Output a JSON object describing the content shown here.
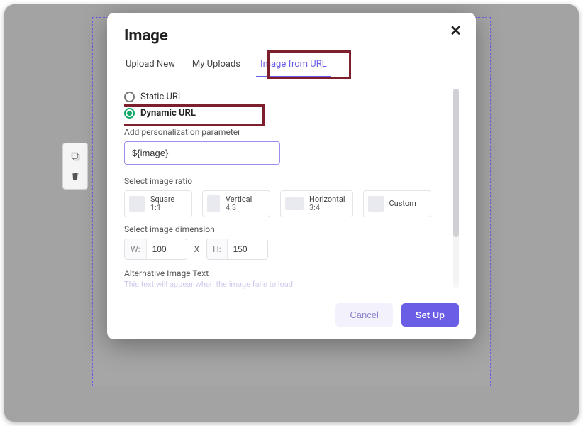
{
  "modal": {
    "title": "Image",
    "tabs": [
      {
        "label": "Upload New",
        "active": false
      },
      {
        "label": "My Uploads",
        "active": false
      },
      {
        "label": "Image from URL",
        "active": true
      }
    ],
    "url_type": {
      "static_label": "Static URL",
      "dynamic_label": "Dynamic URL",
      "selected": "dynamic"
    },
    "param": {
      "label": "Add personalization parameter",
      "value": "${image}"
    },
    "ratio": {
      "label": "Select image ratio",
      "options": [
        {
          "name": "Square",
          "sub": "1:1"
        },
        {
          "name": "Vertical",
          "sub": "4:3"
        },
        {
          "name": "Horizontal",
          "sub": "3:4"
        },
        {
          "name": "Custom",
          "sub": ""
        }
      ]
    },
    "dimension": {
      "label": "Select image dimension",
      "w_prefix": "W:",
      "w_value": "100",
      "x": "X",
      "h_prefix": "H:",
      "h_value": "150"
    },
    "alt": {
      "label": "Alternative Image Text",
      "helper": "This text will appear when the image fails to load"
    },
    "footer": {
      "cancel": "Cancel",
      "setup": "Set Up"
    }
  }
}
